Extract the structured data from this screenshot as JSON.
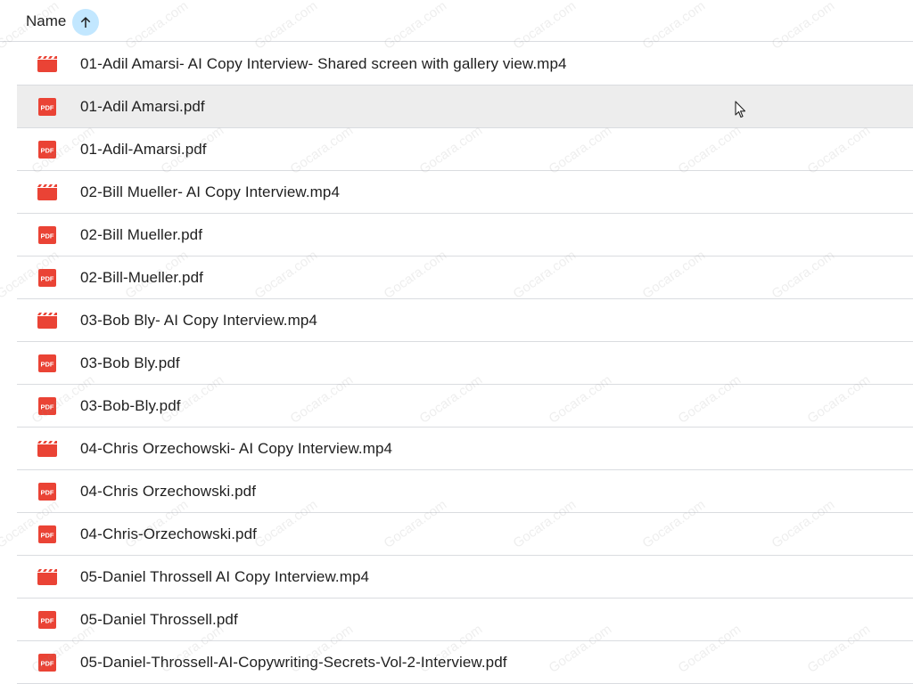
{
  "header": {
    "name_label": "Name",
    "sort_icon": "arrow-up-icon",
    "sort_color": "#c2e7ff"
  },
  "files": [
    {
      "name": "01-Adil Amarsi- AI Copy Interview- Shared screen with gallery view.mp4",
      "type": "video"
    },
    {
      "name": "01-Adil Amarsi.pdf",
      "type": "pdf"
    },
    {
      "name": "01-Adil-Amarsi.pdf",
      "type": "pdf"
    },
    {
      "name": "02-Bill Mueller- AI Copy Interview.mp4",
      "type": "video"
    },
    {
      "name": "02-Bill Mueller.pdf",
      "type": "pdf"
    },
    {
      "name": "02-Bill-Mueller.pdf",
      "type": "pdf"
    },
    {
      "name": "03-Bob Bly- AI Copy Interview.mp4",
      "type": "video"
    },
    {
      "name": "03-Bob Bly.pdf",
      "type": "pdf"
    },
    {
      "name": "03-Bob-Bly.pdf",
      "type": "pdf"
    },
    {
      "name": "04-Chris Orzechowski- AI Copy Interview.mp4",
      "type": "video"
    },
    {
      "name": "04-Chris Orzechowski.pdf",
      "type": "pdf"
    },
    {
      "name": "04-Chris-Orzechowski.pdf",
      "type": "pdf"
    },
    {
      "name": "05-Daniel Throssell AI Copy Interview.mp4",
      "type": "video"
    },
    {
      "name": "05-Daniel Throssell.pdf",
      "type": "pdf"
    },
    {
      "name": "05-Daniel-Throssell-AI-Copywriting-Secrets-Vol-2-Interview.pdf",
      "type": "pdf"
    }
  ],
  "icons": {
    "pdf_label": "PDF",
    "pdf_color": "#ea4335",
    "video_color": "#ea4335"
  },
  "watermark": "Gocara.com"
}
